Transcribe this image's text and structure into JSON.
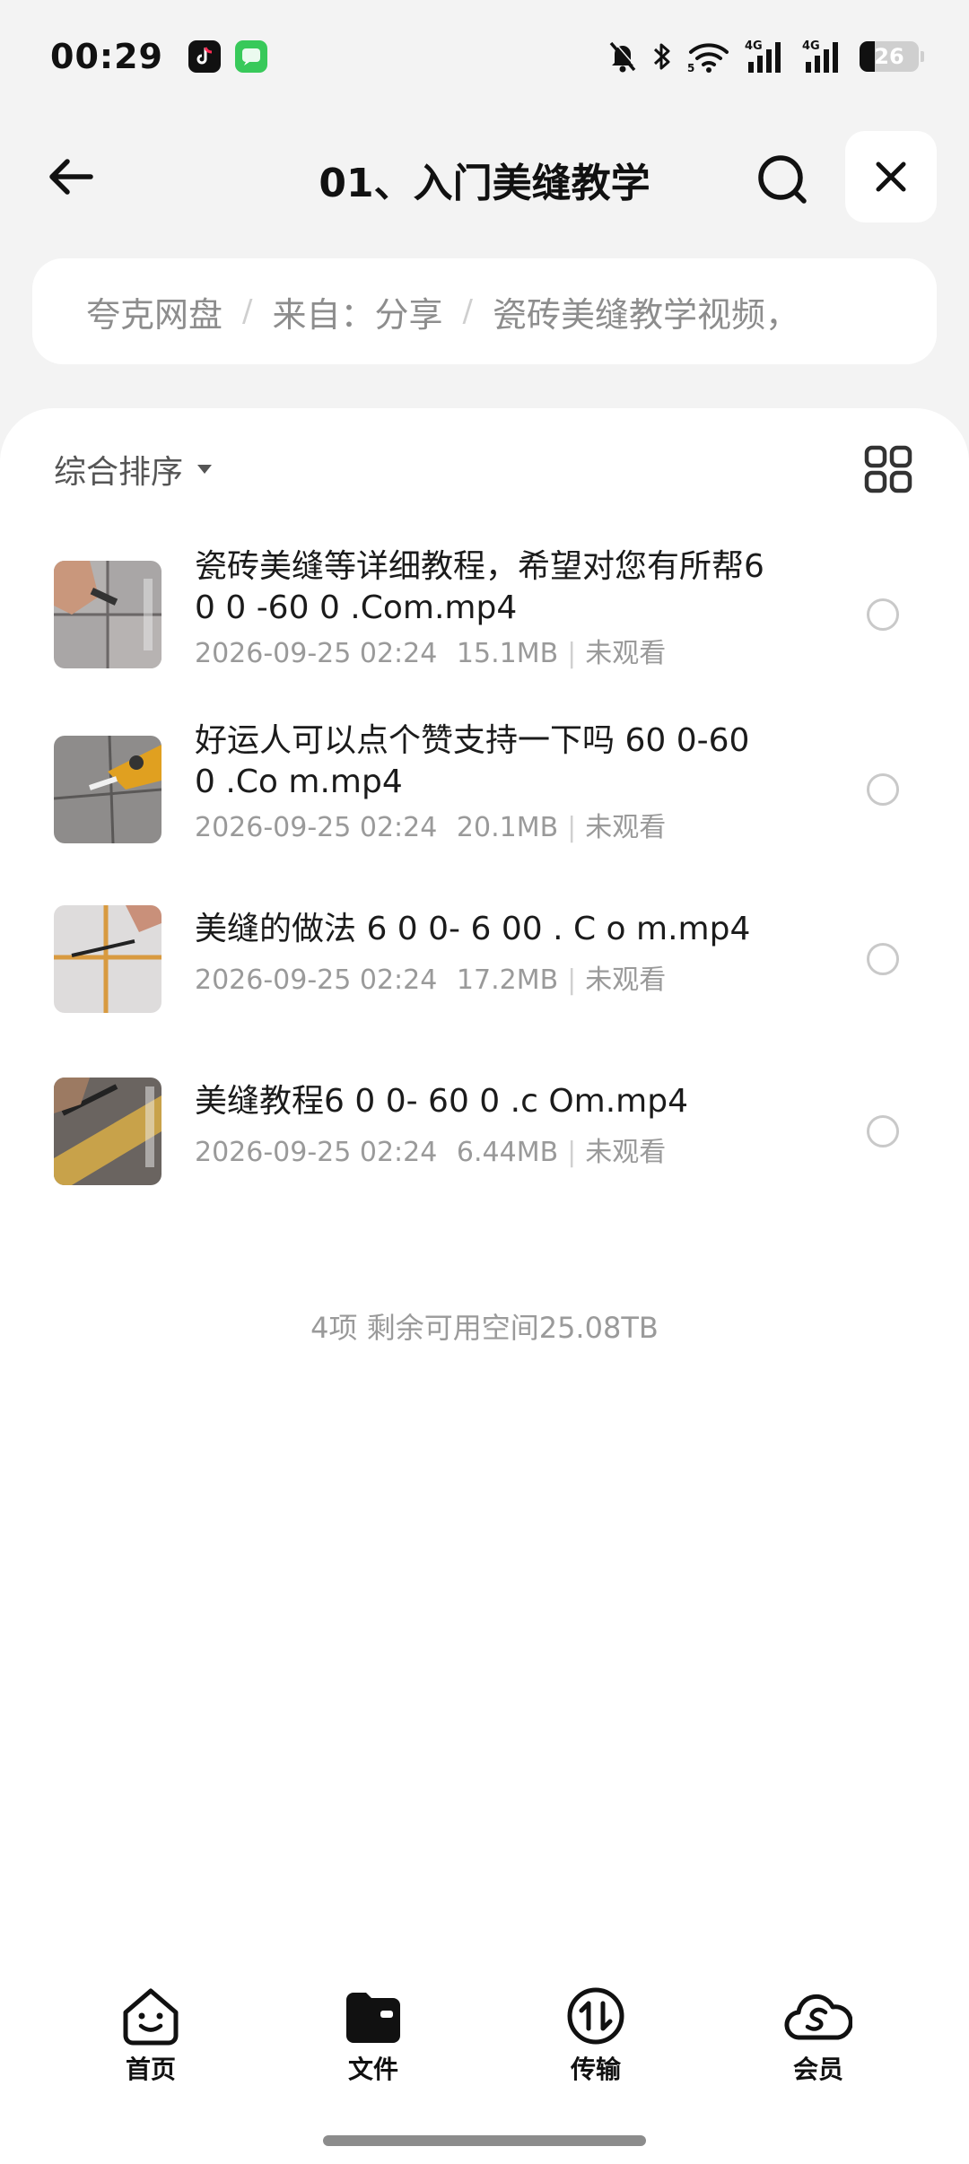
{
  "status_bar": {
    "time": "00:29",
    "battery": "26",
    "network_1": "4G",
    "network_2": "4G",
    "icons": [
      "tiktok-app-icon",
      "message-app-icon",
      "mute-icon",
      "bluetooth-icon",
      "wifi-icon",
      "signal-icon",
      "signal-icon",
      "battery-icon"
    ]
  },
  "header": {
    "title": "01、入门美缝教学",
    "back_icon": "arrow-left-icon",
    "search_icon": "search-icon",
    "close_icon": "close-icon"
  },
  "breadcrumb": {
    "items": [
      "夸克网盘",
      "来自：分享",
      "瓷砖美缝教学视频，"
    ],
    "separator": "/"
  },
  "toolbar": {
    "sort_label": "综合排序",
    "sort_icon": "caret-down-icon",
    "view_icon": "grid-view-icon"
  },
  "files": [
    {
      "name": "瓷砖美缝等详细教程，希望对您有所帮60 0 -60 0 .Com.mp4",
      "date": "2026-09-25 02:24",
      "size": "15.1MB",
      "status": "未观看"
    },
    {
      "name": "好运人可以点个赞支持一下吗 60 0-60 0 .Co m.mp4",
      "date": "2026-09-25 02:24",
      "size": "20.1MB",
      "status": "未观看"
    },
    {
      "name": "美缝的做法 6 0 0- 6 00 . C o m.mp4",
      "date": "2026-09-25 02:24",
      "size": "17.2MB",
      "status": "未观看"
    },
    {
      "name": "美缝教程6 0 0- 60 0 .c Om.mp4",
      "date": "2026-09-25 02:24",
      "size": "6.44MB",
      "status": "未观看"
    }
  ],
  "summary": "4项 剩余可用空间25.08TB",
  "bottom_nav": [
    {
      "label": "首页",
      "icon": "home-smile-icon"
    },
    {
      "label": "文件",
      "icon": "folder-icon"
    },
    {
      "label": "传输",
      "icon": "transfer-icon"
    },
    {
      "label": "会员",
      "icon": "cloud-member-icon"
    }
  ],
  "colors": {
    "background": "#f3f3f3",
    "panel": "#ffffff",
    "primary_text": "#1b1b1b",
    "secondary_text": "#9a9a9a"
  }
}
